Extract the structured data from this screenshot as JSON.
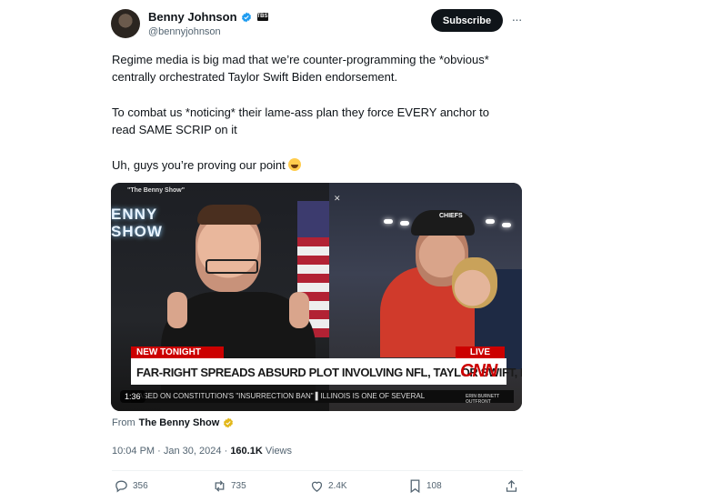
{
  "author": {
    "display_name": "Benny Johnson",
    "handle": "@bennyjohnson",
    "affiliate_badge": "TBS",
    "verified_color": "#1d9bf0"
  },
  "subscribe_label": "Subscribe",
  "more_label": "···",
  "tweet_text": {
    "p1_line1": "Regime media is big mad that we’re counter-programming the *obvious*",
    "p1_line2": "centrally orchestrated Taylor Swift Biden endorsement.",
    "p2_line1": "To combat us *noticing* their lame-ass plan they force EVERY anchor to",
    "p2_line2": "read SAME SCRIP on it",
    "p3": "Uh, guys you’re proving our point",
    "p3_emoji": "rolling-on-floor-laughing"
  },
  "video": {
    "show_tag": "\"The Benny Show\"",
    "sign_text": "ENNY\nSHOW",
    "cap_text": "CHIEFS",
    "banner_left": "NEW TONIGHT",
    "banner_right": "LIVE",
    "headline": "FAR-RIGHT SPREADS ABSURD PLOT INVOLVING NFL, TAYLOR SWIFT, BIDEN",
    "network": "CNN",
    "ticker": "ASED ON CONSTITUTION'S \"INSURRECTION BAN\"  ▌ILLINOIS IS ONE OF SEVERAL",
    "ticker_right": "ERIN BURNETT OUTFRONT",
    "duration": "1:36"
  },
  "source": {
    "from_label": "From",
    "from_name": "The Benny Show",
    "badge_color": "#e2b719"
  },
  "meta": {
    "time": "10:04 PM",
    "date": "Jan 30, 2024",
    "separator": "·",
    "views_count": "160.1K",
    "views_label": "Views"
  },
  "actions": {
    "replies": "356",
    "reposts": "735",
    "likes": "2.4K",
    "bookmarks": "108"
  }
}
